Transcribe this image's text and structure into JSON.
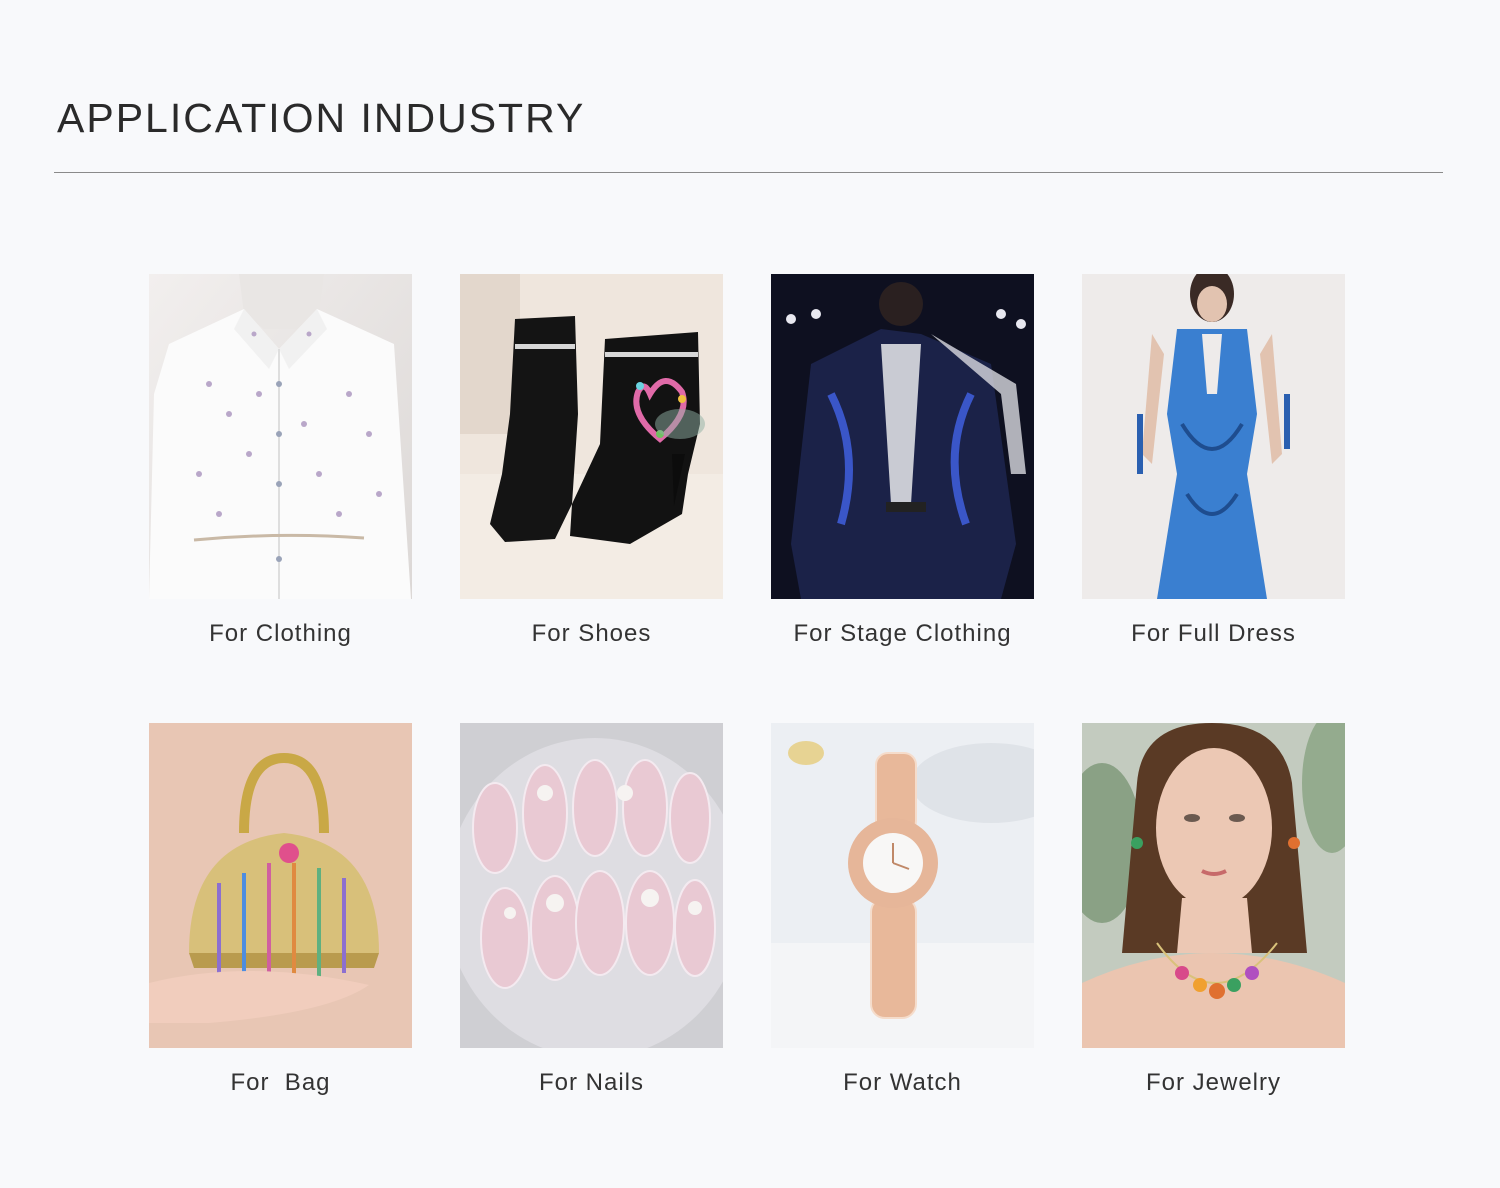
{
  "section": {
    "title": "APPLICATION INDUSTRY"
  },
  "items": [
    {
      "label": "For Clothing",
      "icon": "embellished-white-shirt-image"
    },
    {
      "label": "For Shoes",
      "icon": "rhinestone-ankle-boots-image"
    },
    {
      "label": "For Stage Clothing",
      "icon": "sequin-stage-jacket-image"
    },
    {
      "label": "For Full Dress",
      "icon": "blue-beaded-gown-image"
    },
    {
      "label": "For  Bag",
      "icon": "gold-jeweled-handbag-image"
    },
    {
      "label": "For Nails",
      "icon": "crystal-press-on-nails-image"
    },
    {
      "label": "For Watch",
      "icon": "diamond-bracelet-watch-image"
    },
    {
      "label": "For Jewelry",
      "icon": "gemstone-necklace-model-image"
    }
  ]
}
